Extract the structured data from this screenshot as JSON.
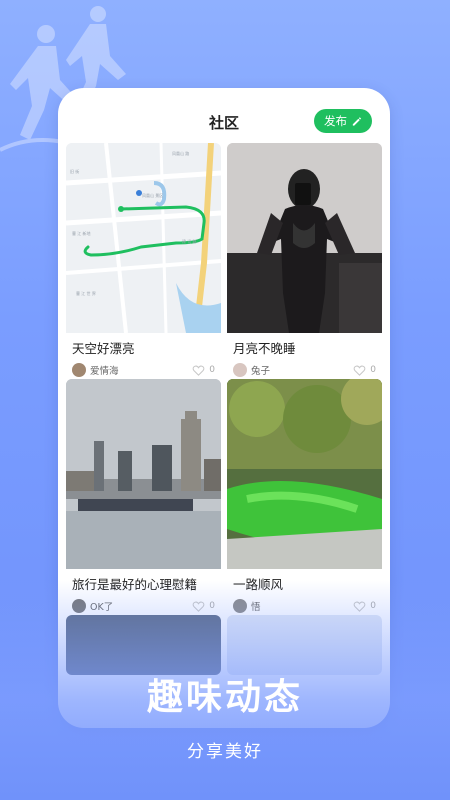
{
  "header": {
    "title": "社区",
    "post_label": "发布"
  },
  "posts": [
    {
      "title": "天空好漂亮",
      "user": "爱情海",
      "likes": "0",
      "image": "map-route"
    },
    {
      "title": "月亮不晚睡",
      "user": "兔子",
      "likes": "0",
      "image": "portrait-photo"
    },
    {
      "title": "旅行是最好的心理慰籍",
      "user": "OK了",
      "likes": "0",
      "image": "city-skyline"
    },
    {
      "title": "一路顺风",
      "user": "悟",
      "likes": "0",
      "image": "green-water"
    }
  ],
  "promo": {
    "headline": "趣味动态",
    "subline": "分享美好"
  },
  "colors": {
    "accent": "#1fbf5f",
    "background": "#7a9dff"
  }
}
